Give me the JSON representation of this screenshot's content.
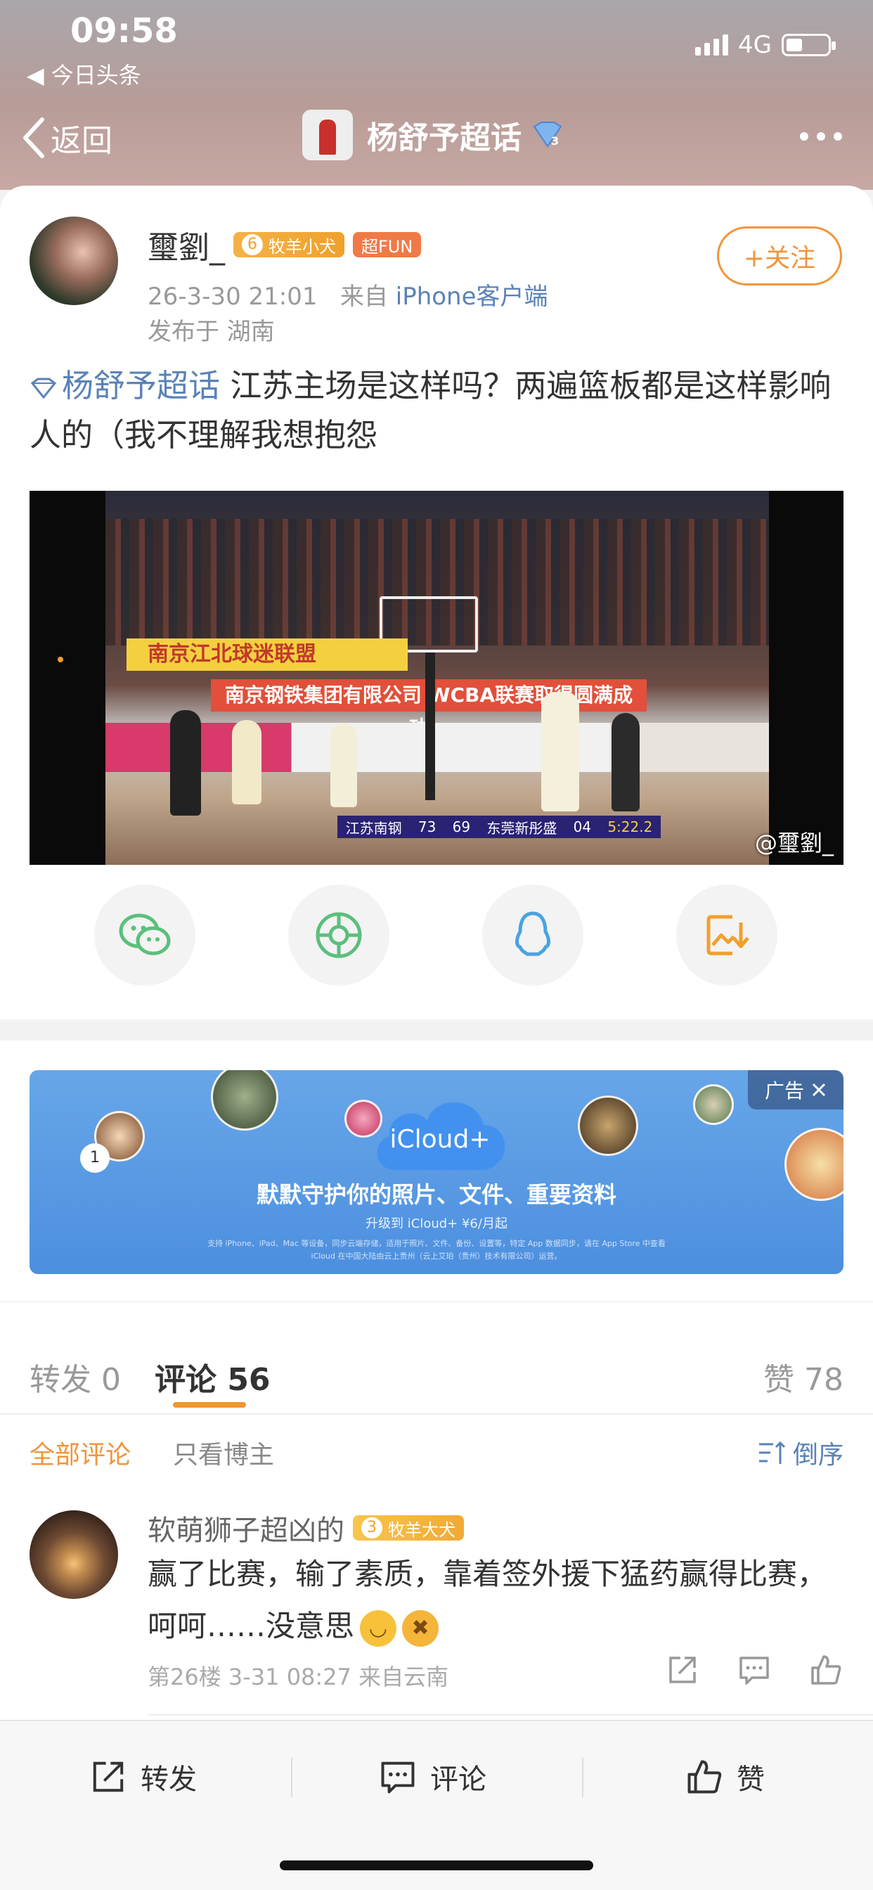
{
  "status_bar": {
    "time": "09:58",
    "back_app": "◀ 今日头条",
    "network": "4G"
  },
  "nav": {
    "back_label": "返回",
    "title": "杨舒予超话"
  },
  "post": {
    "author": "璽劉_",
    "level": "6",
    "level_title": "牧羊小犬",
    "fun_badge": "超FUN",
    "time": "26-3-30 21:01",
    "from_prefix": "来自",
    "client": "iPhone客户端",
    "location": "发布于 湖南",
    "follow_label": "+关注",
    "topic": "杨舒予超话",
    "text": " 江苏主场是这样吗？两遍篮板都是这样影响人的（我不理解我想抱怨",
    "video": {
      "banner_left": "南京江北球迷联盟",
      "banner_center": "南京钢铁集团有限公司 WCBA联赛取得圆满成功！",
      "score_team1": "江苏南钢",
      "score1": "73",
      "score2": "69",
      "score_team2": "东莞新彤盛",
      "quarter": "04",
      "clock": "5:22.2",
      "watermark": "@璽劉_"
    },
    "share_icons": [
      "wechat-icon",
      "moments-icon",
      "qq-icon",
      "save-image-icon"
    ]
  },
  "ad": {
    "product": "iCloud+",
    "headline": "默默守护你的照片、文件、重要资料",
    "sub": "升级到 iCloud+ ¥6/月起",
    "fine1": "支持 iPhone、iPad、Mac 等设备，同步云端存储，适用于照片、文件、备份、设置等，特定 App 数据同步，请在 App Store 中查看",
    "fine2": "iCloud 在中国大陆由云上贵州（云上艾珀（贵州）技术有限公司）运营。",
    "tag": "广告",
    "badge_num": "1"
  },
  "tabs": {
    "repost": "转发 0",
    "comments": "评论 56",
    "likes": "赞 78"
  },
  "filters": {
    "all": "全部评论",
    "host": "只看博主",
    "sort": "倒序"
  },
  "comment": {
    "user": "软萌狮子超凶的",
    "level": "3",
    "level_title": "牧羊大犬",
    "text": "赢了比赛，输了素质，靠着签外援下猛药赢得比赛，呵呵……没意思",
    "meta": "第26楼 3-31 08:27 来自云南"
  },
  "bottom_bar": {
    "repost": "转发",
    "comment": "评论",
    "like": "赞"
  },
  "colors": {
    "accent": "#f0953b",
    "link": "#5a82b7",
    "badge": "#f0a02c"
  }
}
